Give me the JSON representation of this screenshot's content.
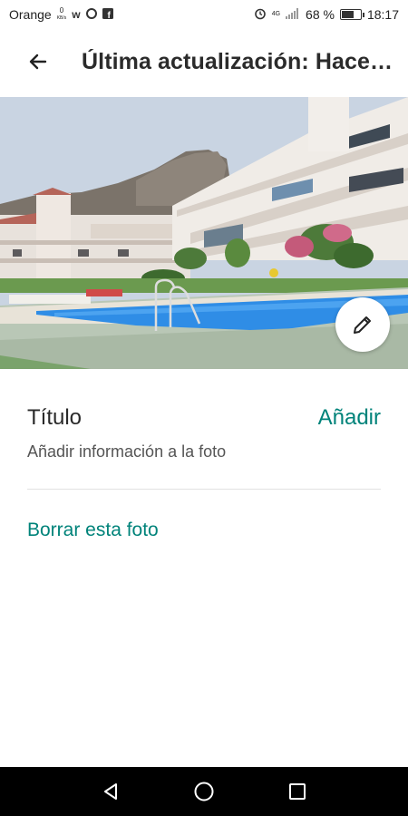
{
  "status_bar": {
    "carrier": "Orange",
    "sim_sub_top": "0",
    "sim_sub_bottom": "KB/s",
    "network_label": "4G",
    "battery_percent": "68 %",
    "battery_level": 0.68,
    "time": "18:17",
    "icons": [
      "w-app-icon",
      "opera-icon",
      "facebook-icon",
      "alarm-icon",
      "signal-icon",
      "battery-icon"
    ]
  },
  "app_bar": {
    "back_icon": "arrow-left-icon",
    "title": "Última actualización: Hace…"
  },
  "photo": {
    "description_icon": "pencil-icon"
  },
  "details": {
    "title_label": "Título",
    "add_label": "Añadir",
    "subtitle": "Añadir información a la foto",
    "delete_label": "Borrar esta foto"
  },
  "colors": {
    "accent": "#00837a",
    "text": "#2a2a2a",
    "nav_bar": "#000000"
  },
  "nav_bar": {
    "icons": [
      "back-triangle-icon",
      "home-circle-icon",
      "recents-square-icon"
    ]
  }
}
